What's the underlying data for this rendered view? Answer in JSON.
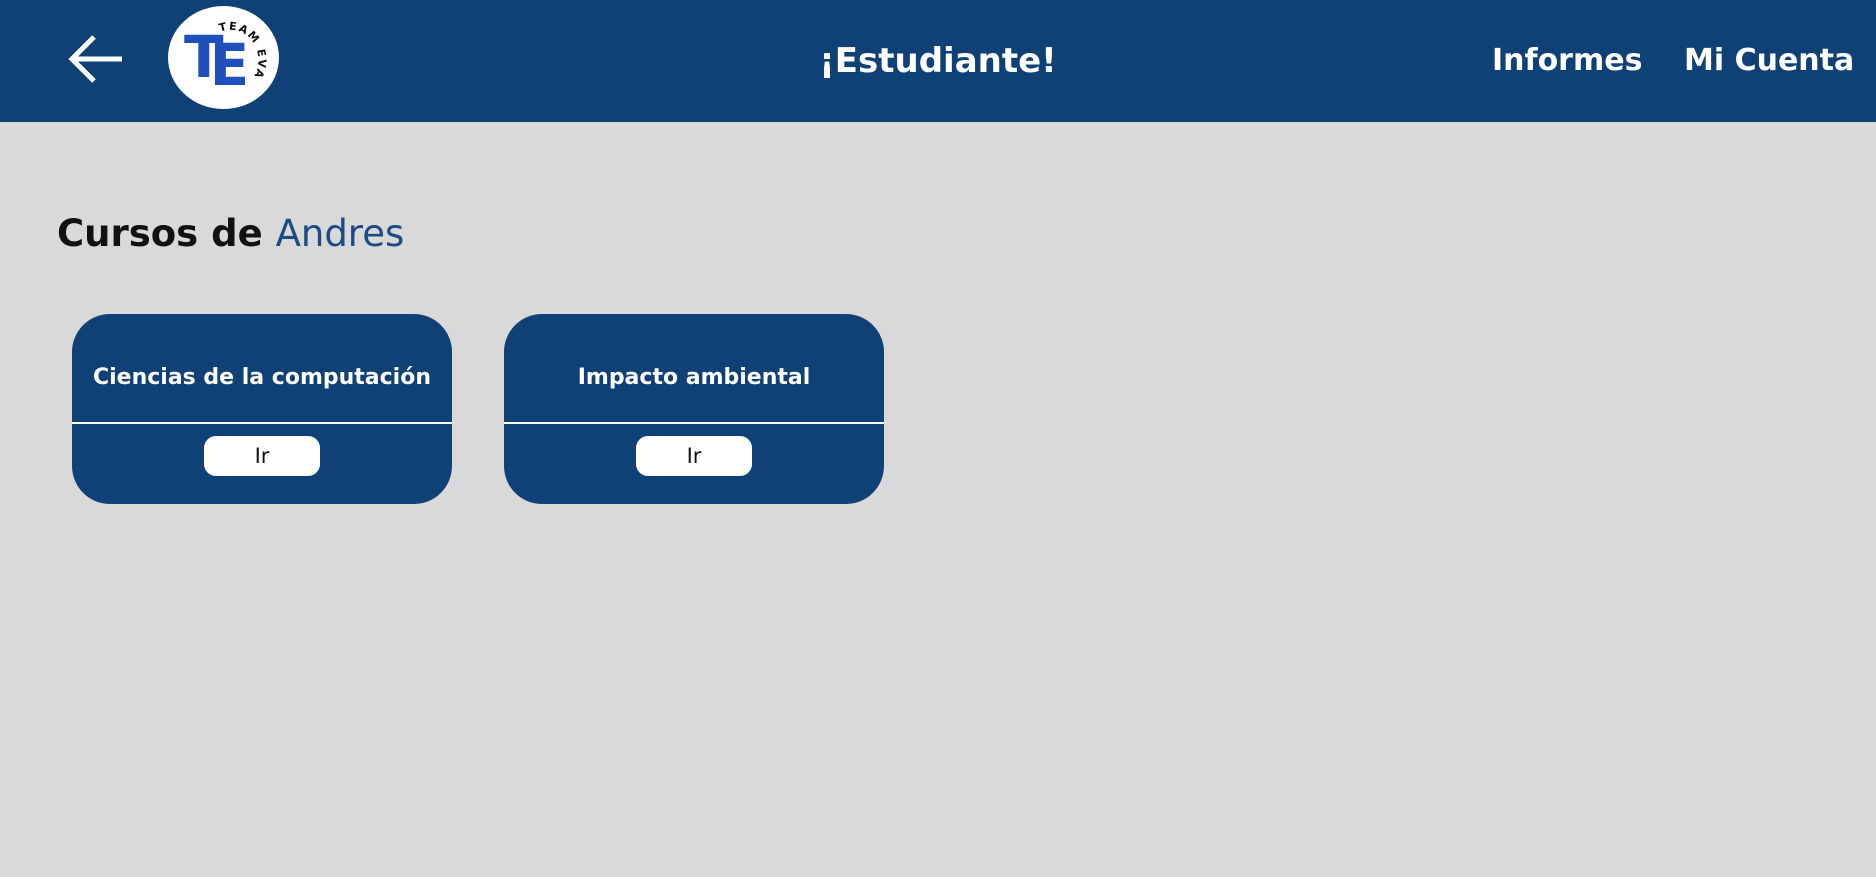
{
  "header": {
    "title": "¡Estudiante!",
    "logo_letters": "TE",
    "logo_arc_text": "TEAM EVAL",
    "nav": [
      {
        "label": "Informes"
      },
      {
        "label": "Mi Cuenta"
      }
    ],
    "icons": {
      "back": "arrow-left-icon"
    }
  },
  "main": {
    "heading_prefix": "Cursos de",
    "user_name": "Andres",
    "courses": [
      {
        "name": "Ciencias de la computación",
        "button_label": "Ir"
      },
      {
        "name": "Impacto ambiental",
        "button_label": "Ir"
      }
    ]
  },
  "colors": {
    "header_bg": "#0f4177",
    "card_bg": "#0f4177",
    "page_bg": "#d9d9d9",
    "accent_name": "#1b4a85",
    "logo_letters": "#1f4fbd"
  }
}
